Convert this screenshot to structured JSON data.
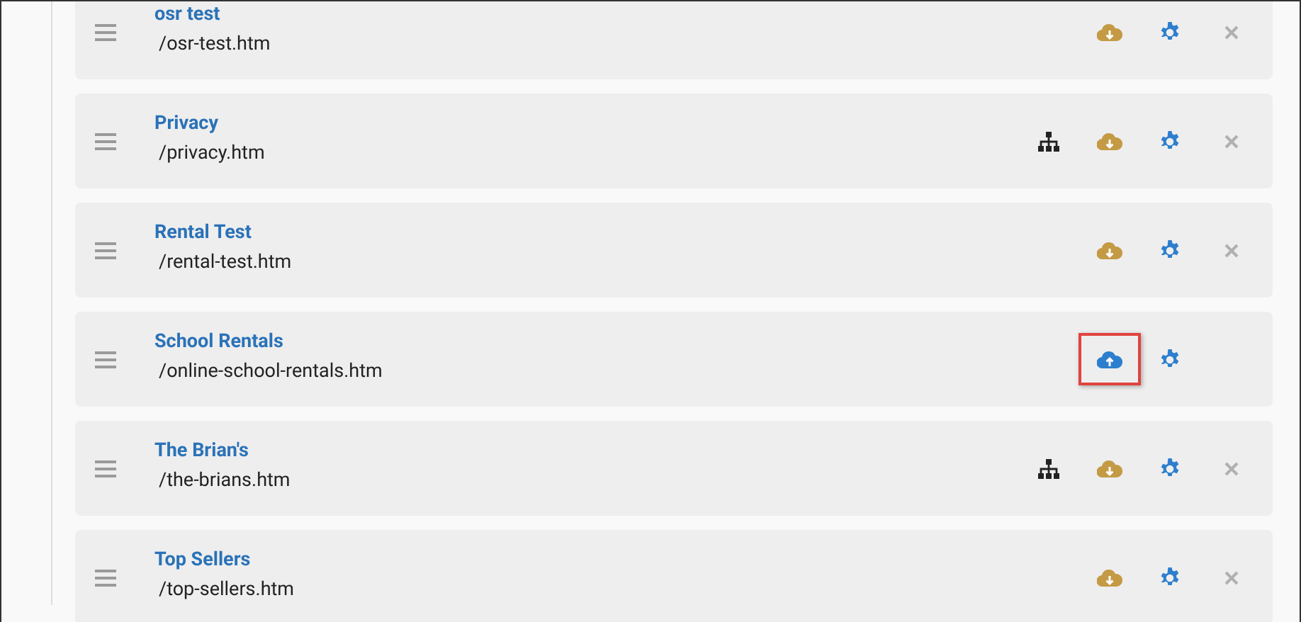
{
  "pages": [
    {
      "title": "osr test",
      "path": "/osr-test.htm",
      "sitemap": false,
      "uploaded": false,
      "highlighted": false,
      "removable": true
    },
    {
      "title": "Privacy",
      "path": "/privacy.htm",
      "sitemap": true,
      "uploaded": false,
      "highlighted": false,
      "removable": true
    },
    {
      "title": "Rental Test",
      "path": "/rental-test.htm",
      "sitemap": false,
      "uploaded": false,
      "highlighted": false,
      "removable": true
    },
    {
      "title": "School Rentals",
      "path": "/online-school-rentals.htm",
      "sitemap": false,
      "uploaded": true,
      "highlighted": true,
      "removable": false
    },
    {
      "title": "The Brian's",
      "path": "/the-brians.htm",
      "sitemap": true,
      "uploaded": false,
      "highlighted": false,
      "removable": true
    },
    {
      "title": "Top Sellers",
      "path": "/top-sellers.htm",
      "sitemap": false,
      "uploaded": false,
      "highlighted": false,
      "removable": true
    }
  ]
}
